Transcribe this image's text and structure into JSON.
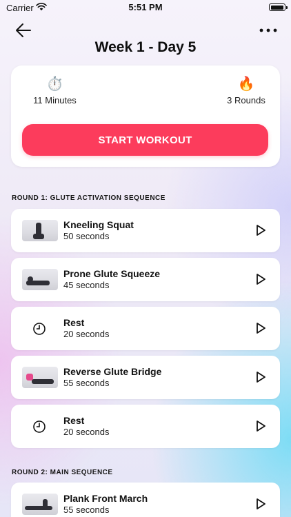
{
  "status_bar": {
    "carrier": "Carrier",
    "time": "5:51 PM"
  },
  "header": {
    "title": "Week 1 - Day 5",
    "back_icon": "arrow-left-icon",
    "more_icon": "more-horizontal-icon"
  },
  "summary": {
    "duration": {
      "icon": "⏱️",
      "text": "11 Minutes"
    },
    "rounds": {
      "icon": "🔥",
      "text": "3 Rounds"
    },
    "start_button": "START WORKOUT",
    "accent_color": "#fc3c5c"
  },
  "sections": [
    {
      "heading": "ROUND 1: GLUTE ACTIVATION SEQUENCE",
      "items": [
        {
          "title": "Kneeling Squat",
          "subtitle": "50 seconds",
          "kind": "exercise"
        },
        {
          "title": "Prone Glute Squeeze",
          "subtitle": "45 seconds",
          "kind": "exercise"
        },
        {
          "title": "Rest",
          "subtitle": "20 seconds",
          "kind": "rest"
        },
        {
          "title": "Reverse Glute Bridge",
          "subtitle": "55 seconds",
          "kind": "exercise"
        },
        {
          "title": "Rest",
          "subtitle": "20 seconds",
          "kind": "rest"
        }
      ]
    },
    {
      "heading": "ROUND 2: MAIN SEQUENCE",
      "items": [
        {
          "title": "Plank Front March",
          "subtitle": "55 seconds",
          "kind": "exercise"
        }
      ]
    }
  ]
}
